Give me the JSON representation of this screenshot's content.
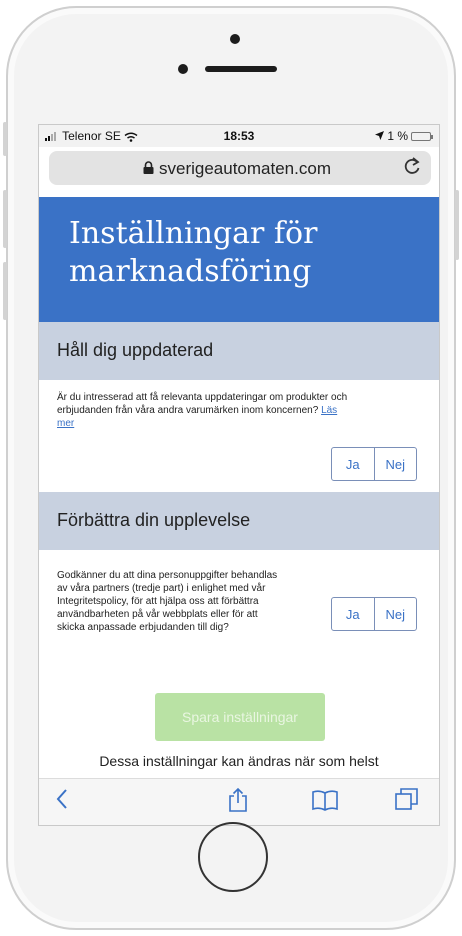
{
  "status_bar": {
    "carrier": "Telenor SE",
    "time": "18:53",
    "battery": "1 %"
  },
  "browser": {
    "url": "sverigeautomaten.com"
  },
  "page": {
    "title": "Inställningar för marknadsföring"
  },
  "section1": {
    "heading": "Håll dig uppdaterad",
    "text": "Är du intresserad att få relevanta uppdateringar om produkter och erbjudanden från våra andra varumärken inom koncernen?",
    "link": "Läs mer",
    "yes_label": "Ja",
    "no_label": "Nej"
  },
  "section2": {
    "heading": "Förbättra din upplevelse",
    "text": "Godkänner du att dina personuppgifter behandlas av våra partners (tredje part) i enlighet med vår Integritetspolicy, för att hjälpa oss att förbättra användbarheten på vår webbplats eller för att skicka anpassade erbjudanden till dig?",
    "yes_label": "Ja",
    "no_label": "Nej"
  },
  "save_button": {
    "label": "Spara inställningar"
  },
  "footer_note": "Dessa inställningar kan ändras när som helst",
  "colors": {
    "banner": "#3a72c6",
    "section_header": "#c8d1e0",
    "save_button_disabled": "#b9e2a4",
    "accent": "#3a72c6"
  },
  "icons": [
    "back-chevron-icon",
    "share-icon",
    "bookmarks-icon",
    "tabs-icon",
    "lock-icon",
    "reload-icon",
    "wifi-icon",
    "signal-icon",
    "battery-icon",
    "location-arrow-icon"
  ]
}
